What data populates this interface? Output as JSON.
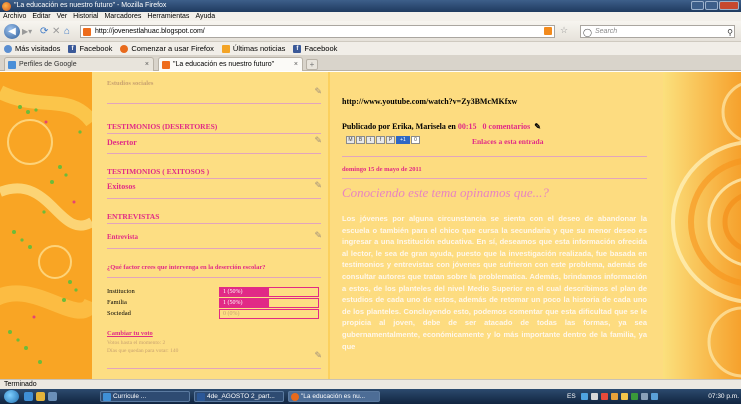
{
  "window": {
    "title": "\"La educación es nuestro futuro\" - Mozilla Firefox"
  },
  "menu": [
    "Archivo",
    "Editar",
    "Ver",
    "Historial",
    "Marcadores",
    "Herramientas",
    "Ayuda"
  ],
  "nav": {
    "url": "http://jovenestlahuac.blogspot.com/",
    "search_placeholder": "Search"
  },
  "bookmarks": [
    "Más visitados",
    "Facebook",
    "Comenzar a usar Firefox",
    "Últimas noticias",
    "Facebook"
  ],
  "tabs": [
    {
      "label": "Perfiles de Google",
      "close": "×"
    },
    {
      "label": "\"La educación es nuestro futuro\"",
      "close": "×"
    }
  ],
  "new_tab": "+",
  "sidebar": {
    "top_cut": "Estudios sociales",
    "sections": [
      {
        "heading": "TESTIMONIOS (DESERTORES)",
        "link": "Desertor"
      },
      {
        "heading": "TESTIMONIOS ( EXITOSOS )",
        "link": "Exitosos"
      },
      {
        "heading": "ENTREVISTAS",
        "link": "Entrevista"
      }
    ],
    "poll": {
      "question": "¿Qué factor crees que intervenga en la deserción escolar?",
      "options": [
        {
          "label": "Institucion",
          "percent_text": "1 (50%)",
          "value": 0.5
        },
        {
          "label": "Familia",
          "percent_text": "1 (50%)",
          "value": 0.5
        },
        {
          "label": "Sociedad",
          "percent_text": "0 (0%)",
          "value": 0
        }
      ],
      "change_vote": "Cambiar tu voto",
      "votes_note": "Votos hasta el momento: 2",
      "days_note": "Días que quedan para votar: 140"
    }
  },
  "main": {
    "youtube_url": "http://www.youtube.com/watch?v=Zy3BMcMKfxw",
    "published_by": "Publicado por Erika, Marisela en",
    "time": "00:15",
    "comments": "0 comentarios",
    "share_buttons": [
      "M",
      "B",
      "t",
      "f",
      "P"
    ],
    "plus_one": "+1",
    "plus_count": "0",
    "links_to": "Enlaces a esta entrada",
    "date": "domingo 15 de mayo de 2011",
    "post_title": "Conociendo este tema opinamos que...?",
    "post_body": "Los jóvenes por alguna circunstancia se sienta con el deseo de abandonar la escuela o también para el chico que cursa la secundaria y que su menor deseo es ingresar a una Institución educativa. En sí, deseamos que esta información ofrecida al lector, le sea de gran ayuda, puesto que la investigación realizada, fue basada en testimonios y entrevistas con jóvenes que sufrieron con este problema, además de consultar autores que tratan sobre la problematica. Además, brindamos información a estos, de los planteles del nivel Medio Superior en el cual describimos el plan de estudios de cada uno de estos, además de retomar un poco la historia de cada uno de los planteles. Concluyendo esto, podemos comentar que esta dificultad que se le propicia al joven, debe de ser atacado de todas las formas, ya sea gubernamentalmente, económicamente y lo más importante dentro de la familia, ya que"
  },
  "status": "Terminado",
  "taskbar": {
    "items": [
      "Curricule ...",
      "4de_AGOSTO 2_part...",
      "\"La educación es nu..."
    ],
    "lang": "ES",
    "clock": "07:30 p.m."
  },
  "colors": {
    "accent_pink": "#e12a86",
    "title_pink": "#e884c0",
    "page_bg": "#fddc80"
  }
}
